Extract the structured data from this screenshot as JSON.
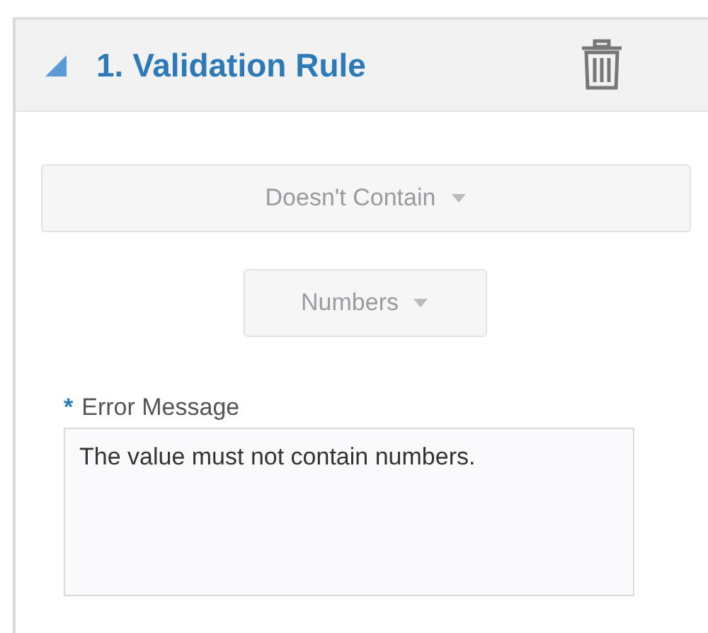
{
  "panel": {
    "title": "1. Validation Rule",
    "expanded": true
  },
  "dropdowns": [
    {
      "kind": "wide",
      "value": "Doesn't Contain"
    },
    {
      "kind": "narrow",
      "value": "Numbers"
    }
  ],
  "error_message": {
    "required_mark": "*",
    "label": "Error Message",
    "value": "The value must not contain numbers."
  }
}
